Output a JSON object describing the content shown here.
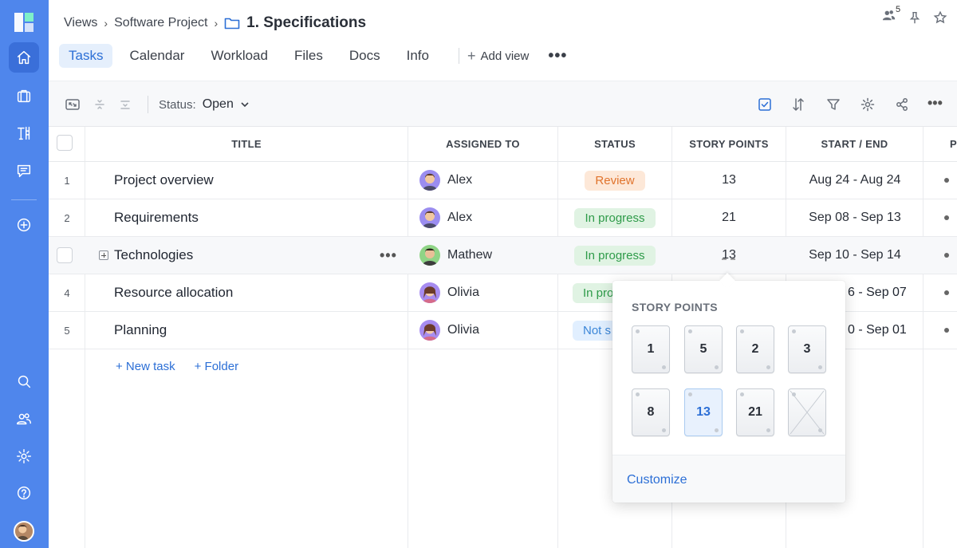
{
  "breadcrumb": {
    "views": "Views",
    "project": "Software Project",
    "title": "1. Specifications"
  },
  "header": {
    "members_count": "5"
  },
  "tabs": [
    {
      "label": "Tasks",
      "active": true
    },
    {
      "label": "Calendar"
    },
    {
      "label": "Workload"
    },
    {
      "label": "Files"
    },
    {
      "label": "Docs"
    },
    {
      "label": "Info"
    }
  ],
  "add_view_label": "Add view",
  "toolbar": {
    "status_label": "Status:",
    "status_value": "Open"
  },
  "columns": {
    "title": "TITLE",
    "assigned": "ASSIGNED TO",
    "status": "STATUS",
    "points": "STORY POINTS",
    "dates": "START / END",
    "extra": "P"
  },
  "rows": [
    {
      "num": "1",
      "title": "Project overview",
      "assignee": "Alex",
      "status": "Review",
      "points": "13",
      "dates": "Aug 24 - Aug 24"
    },
    {
      "num": "2",
      "title": "Requirements",
      "assignee": "Alex",
      "status": "In progress",
      "points": "21",
      "dates": "Sep 08 - Sep 13"
    },
    {
      "num": "",
      "title": "Technologies",
      "assignee": "Mathew",
      "status": "In progress",
      "points": "13",
      "dates": "Sep 10 - Sep 14"
    },
    {
      "num": "4",
      "title": "Resource allocation",
      "assignee": "Olivia",
      "status": "In pro",
      "points": "",
      "dates": "6 - Sep 07"
    },
    {
      "num": "5",
      "title": "Planning",
      "assignee": "Olivia",
      "status": "Not s",
      "points": "",
      "dates": "0 - Sep 01"
    }
  ],
  "add_links": {
    "new_task": "+ New task",
    "folder": "+ Folder"
  },
  "popup": {
    "title": "STORY POINTS",
    "cards": [
      "1",
      "5",
      "2",
      "3",
      "8",
      "13",
      "21"
    ],
    "selected": "13",
    "customize": "Customize"
  },
  "colors": {
    "accent": "#2c6fd6",
    "sidebar": "#4f86ec",
    "review": "#e0732c",
    "in_progress": "#2e9b49",
    "not_started": "#3b86d8"
  }
}
